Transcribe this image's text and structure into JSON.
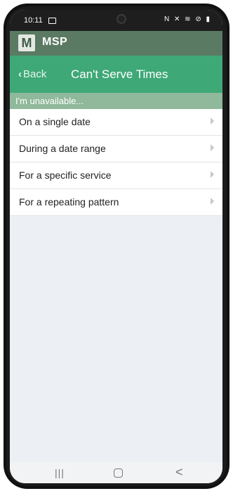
{
  "status_bar": {
    "time": "10:11",
    "icons": "N ✕ ≋ ⊘ ▮"
  },
  "app_bar": {
    "logo_letter": "M",
    "app_name": "MSP"
  },
  "nav_bar": {
    "back_label": "Back",
    "title": "Can't Serve Times"
  },
  "section": {
    "header": "I'm unavailable..."
  },
  "list": {
    "items": [
      {
        "label": "On a single date"
      },
      {
        "label": "During a date range"
      },
      {
        "label": "For a specific service"
      },
      {
        "label": "For a repeating pattern"
      }
    ]
  },
  "system_nav": {
    "recent": "|||",
    "back": "<"
  },
  "colors": {
    "app_bar": "#5b7a63",
    "nav_bar": "#3ea877",
    "section_header": "#8fb99a",
    "background": "#eceff3"
  }
}
